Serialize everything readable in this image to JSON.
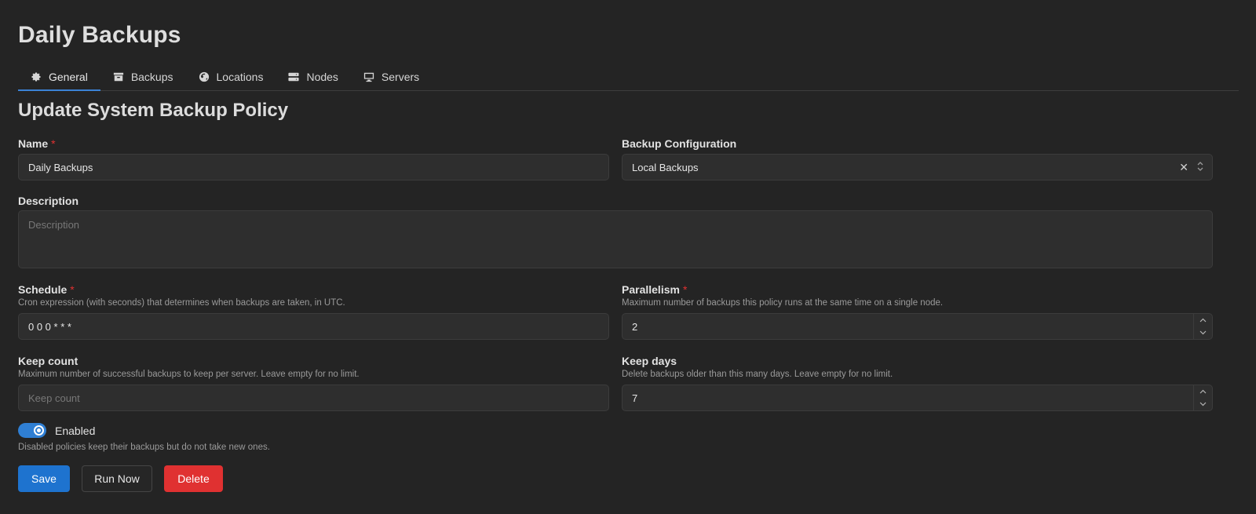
{
  "page": {
    "title": "Daily Backups"
  },
  "tabs": [
    {
      "label": "General",
      "icon": "gear-icon",
      "active": true
    },
    {
      "label": "Backups",
      "icon": "archive-icon"
    },
    {
      "label": "Locations",
      "icon": "globe-icon"
    },
    {
      "label": "Nodes",
      "icon": "server-icon"
    },
    {
      "label": "Servers",
      "icon": "monitor-icon"
    }
  ],
  "form": {
    "title": "Update System Backup Policy",
    "name": {
      "label": "Name",
      "required": "*",
      "value": "Daily Backups"
    },
    "backup_configuration": {
      "label": "Backup Configuration",
      "value": "Local Backups"
    },
    "description": {
      "label": "Description",
      "placeholder": "Description",
      "value": ""
    },
    "schedule": {
      "label": "Schedule",
      "required": "*",
      "hint": "Cron expression (with seconds) that determines when backups are taken, in UTC.",
      "value": "0 0 0 * * *"
    },
    "parallelism": {
      "label": "Parallelism",
      "required": "*",
      "hint": "Maximum number of backups this policy runs at the same time on a single node.",
      "value": "2"
    },
    "keep_count": {
      "label": "Keep count",
      "hint": "Maximum number of successful backups to keep per server. Leave empty for no limit.",
      "placeholder": "Keep count",
      "value": ""
    },
    "keep_days": {
      "label": "Keep days",
      "hint": "Delete backups older than this many days. Leave empty for no limit.",
      "value": "7"
    },
    "enabled": {
      "label": "Enabled",
      "on": true,
      "hint": "Disabled policies keep their backups but do not take new ones."
    }
  },
  "buttons": {
    "save": "Save",
    "run_now": "Run Now",
    "delete": "Delete"
  },
  "colors": {
    "accent": "#1e73cf",
    "danger": "#e03131",
    "background": "#242424"
  }
}
